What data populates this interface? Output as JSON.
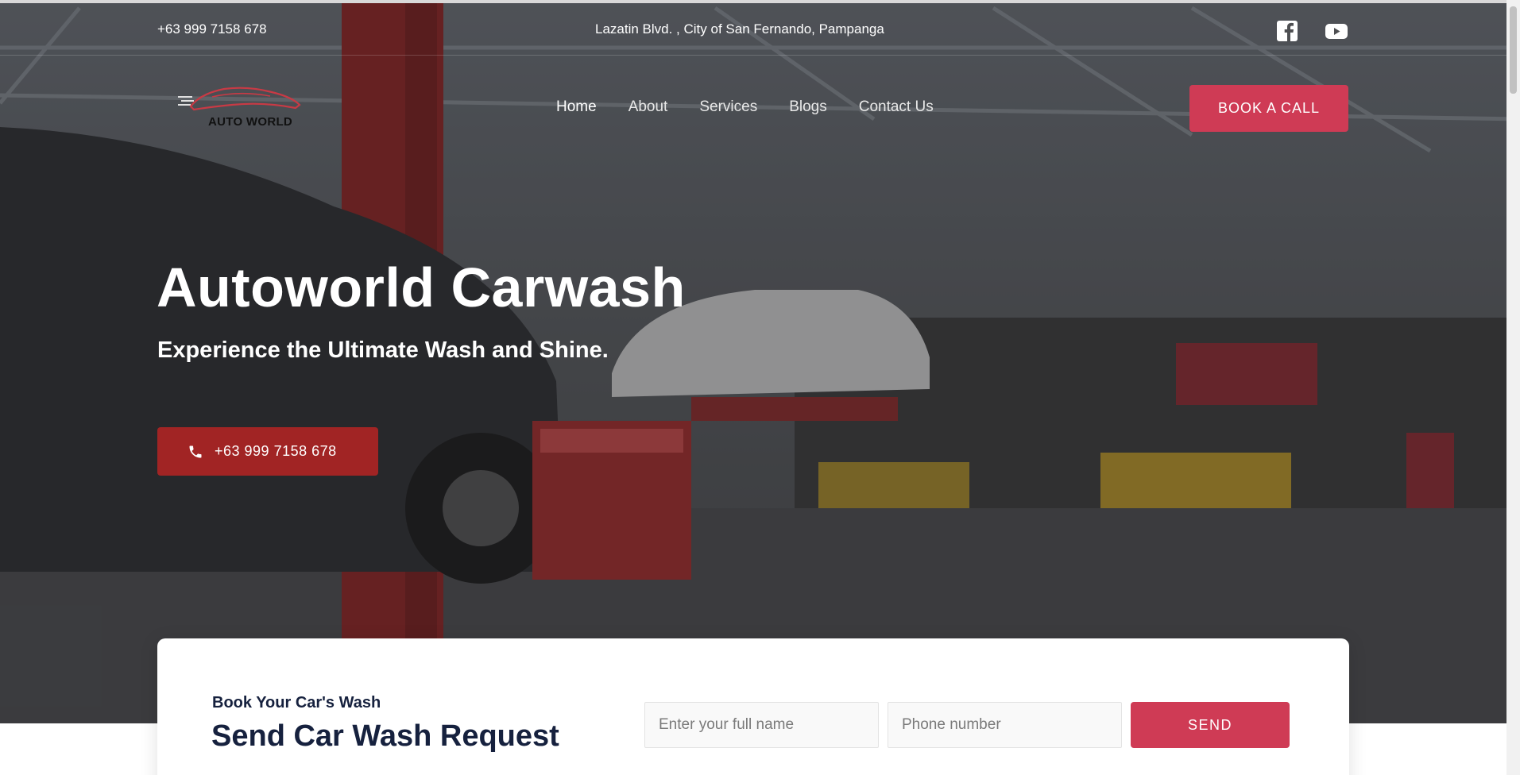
{
  "topbar": {
    "phone": "+63 999 7158 678",
    "address": "Lazatin Blvd. , City of San Fernando, Pampanga",
    "social_icons": [
      "facebook-icon",
      "youtube-icon"
    ]
  },
  "logo": {
    "text": "AUTO WORLD"
  },
  "nav": {
    "items": [
      {
        "label": "Home",
        "active": true
      },
      {
        "label": "About"
      },
      {
        "label": "Services"
      },
      {
        "label": "Blogs"
      },
      {
        "label": "Contact Us"
      }
    ]
  },
  "header": {
    "cta_label": "BOOK A CALL"
  },
  "hero": {
    "title": "Autoworld Carwash",
    "subtitle": "Experience the Ultimate Wash and Shine.",
    "call_button_label": "+63 999 7158 678"
  },
  "booking": {
    "eyebrow": "Book Your Car's Wash",
    "heading": "Send Car Wash Request",
    "name_placeholder": "Enter your full name",
    "phone_placeholder": "Phone number",
    "send_label": "SEND"
  },
  "colors": {
    "accent": "#cf3b55",
    "call_button": "#a12424",
    "heading_navy": "#16213e"
  }
}
